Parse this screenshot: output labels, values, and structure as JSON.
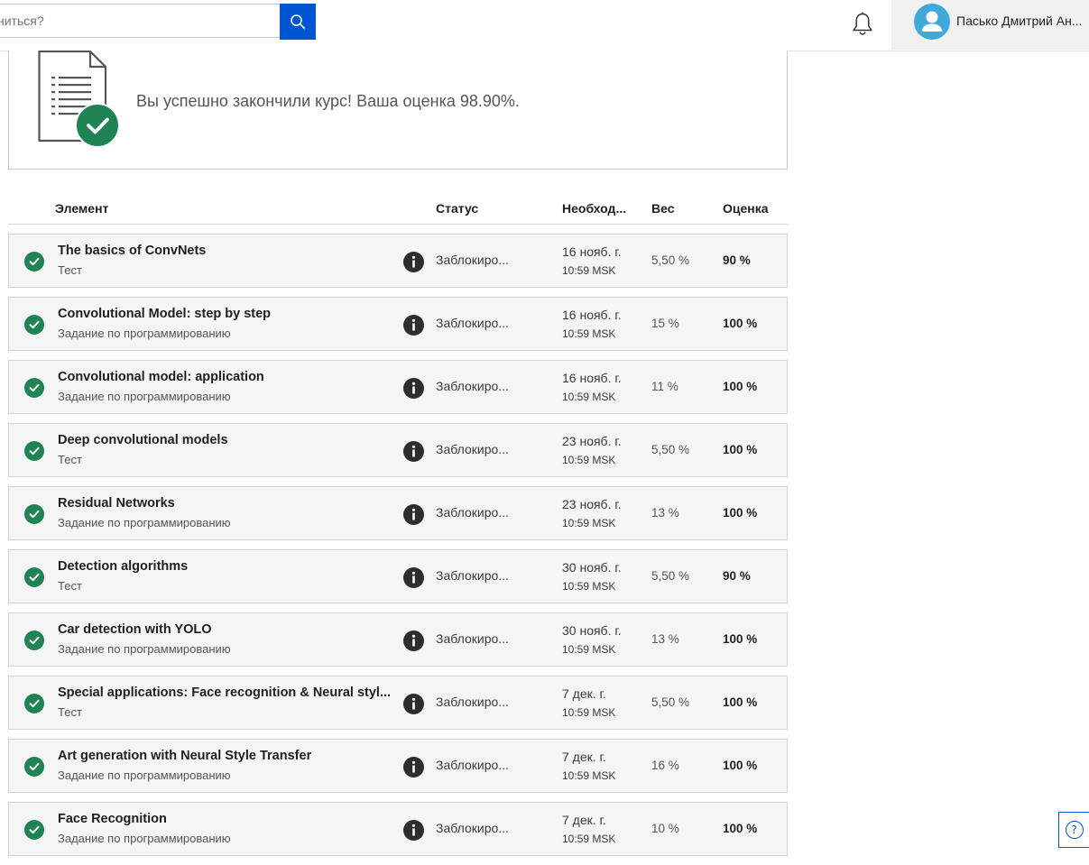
{
  "header": {
    "search_placeholder": "ниться?",
    "user_name": "Пасько Дмитрий Ан..."
  },
  "completion": {
    "message": "Вы успешно закончили курс! Ваша оценка 98.90%."
  },
  "table": {
    "columns": {
      "item": "Элемент",
      "status": "Статус",
      "due": "Необход...",
      "weight": "Вес",
      "grade": "Оценка"
    },
    "rows": [
      {
        "title": "The basics of ConvNets",
        "type": "Тест",
        "status": "Заблокиро...",
        "due_date": "16 нояб. г.",
        "due_time": "10:59 MSK",
        "weight": "5,50 %",
        "grade": "90 %"
      },
      {
        "title": "Convolutional Model: step by step",
        "type": "Задание по программированию",
        "status": "Заблокиро...",
        "due_date": "16 нояб. г.",
        "due_time": "10:59 MSK",
        "weight": "15 %",
        "grade": "100 %"
      },
      {
        "title": "Convolutional model: application",
        "type": "Задание по программированию",
        "status": "Заблокиро...",
        "due_date": "16 нояб. г.",
        "due_time": "10:59 MSK",
        "weight": "11 %",
        "grade": "100 %"
      },
      {
        "title": "Deep convolutional models",
        "type": "Тест",
        "status": "Заблокиро...",
        "due_date": "23 нояб. г.",
        "due_time": "10:59 MSK",
        "weight": "5,50 %",
        "grade": "100 %"
      },
      {
        "title": "Residual Networks",
        "type": "Задание по программированию",
        "status": "Заблокиро...",
        "due_date": "23 нояб. г.",
        "due_time": "10:59 MSK",
        "weight": "13 %",
        "grade": "100 %"
      },
      {
        "title": "Detection algorithms",
        "type": "Тест",
        "status": "Заблокиро...",
        "due_date": "30 нояб. г.",
        "due_time": "10:59 MSK",
        "weight": "5,50 %",
        "grade": "90 %"
      },
      {
        "title": "Car detection with YOLO",
        "type": "Задание по программированию",
        "status": "Заблокиро...",
        "due_date": "30 нояб. г.",
        "due_time": "10:59 MSK",
        "weight": "13 %",
        "grade": "100 %"
      },
      {
        "title": "Special applications: Face recognition & Neural styl...",
        "type": "Тест",
        "status": "Заблокиро...",
        "due_date": "7 дек. г.",
        "due_time": "10:59 MSK",
        "weight": "5,50 %",
        "grade": "100 %"
      },
      {
        "title": "Art generation with Neural Style Transfer",
        "type": "Задание по программированию",
        "status": "Заблокиро...",
        "due_date": "7 дек. г.",
        "due_time": "10:59 MSK",
        "weight": "16 %",
        "grade": "100 %"
      },
      {
        "title": "Face Recognition",
        "type": "Задание по программированию",
        "status": "Заблокиро...",
        "due_date": "7 дек. г.",
        "due_time": "10:59 MSK",
        "weight": "10 %",
        "grade": "100 %"
      }
    ]
  },
  "help": {
    "label": "?"
  },
  "colors": {
    "accent": "#0056d2",
    "success": "#1f8354",
    "avatar": "#3fa9d9",
    "row_bg": "#f5f5f5"
  },
  "icons": [
    "search-icon",
    "bell-icon",
    "user-icon",
    "document-icon",
    "check-icon",
    "info-icon",
    "help-icon"
  ]
}
